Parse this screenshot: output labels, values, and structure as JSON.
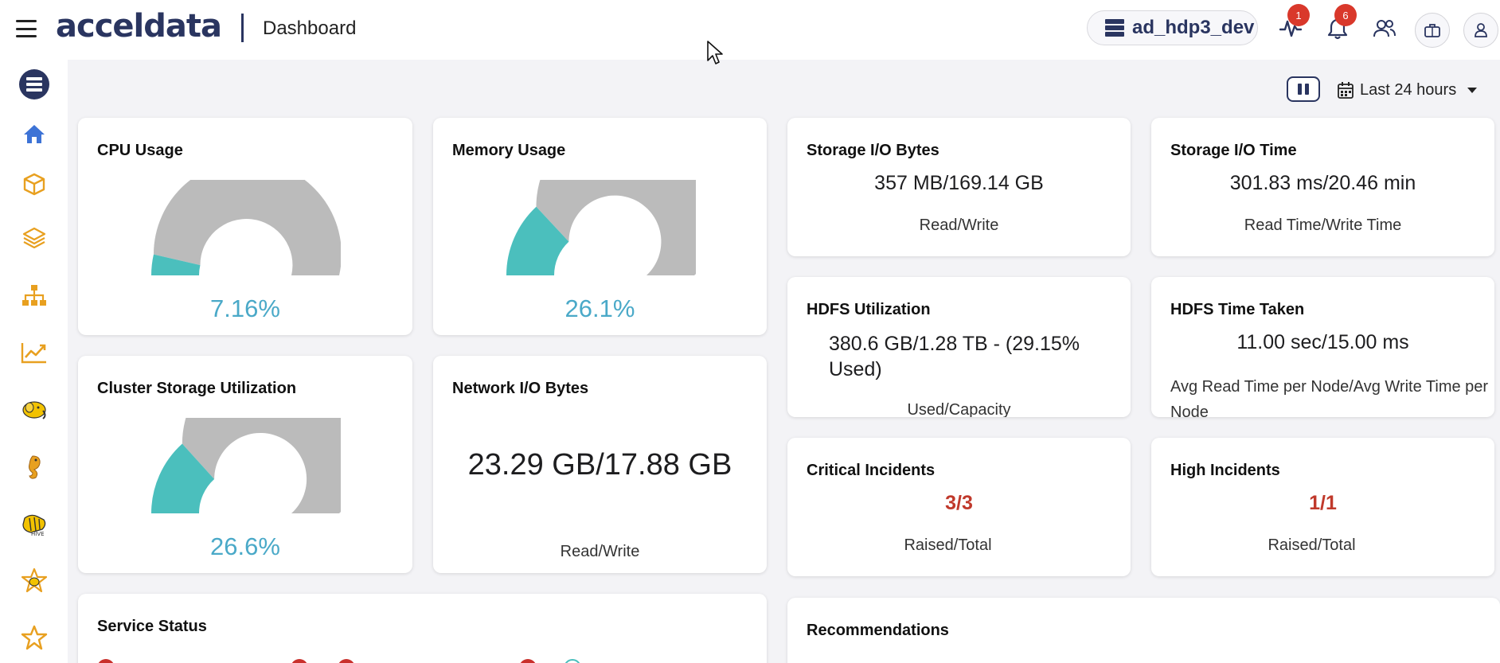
{
  "header": {
    "logo_text": "acceldata",
    "page_title": "Dashboard",
    "cluster_name": "ad_hdp3_dev",
    "alerts_badge": "1",
    "notifications_badge": "6"
  },
  "controls": {
    "time_range": "Last 24 hours"
  },
  "cards": {
    "cpu": {
      "title": "CPU Usage",
      "value": "7.16%",
      "fraction": 0.0716
    },
    "memory": {
      "title": "Memory Usage",
      "value": "26.1%",
      "fraction": 0.261
    },
    "cluster_storage": {
      "title": "Cluster Storage Utilization",
      "value": "26.6%",
      "fraction": 0.266
    },
    "network_io": {
      "title": "Network I/O Bytes",
      "value": "23.29 GB/17.88 GB",
      "label": "Read/Write"
    },
    "storage_io_bytes": {
      "title": "Storage I/O Bytes",
      "value": "357 MB/169.14 GB",
      "label": "Read/Write"
    },
    "storage_io_time": {
      "title": "Storage I/O Time",
      "value": "301.83 ms/20.46 min",
      "label": "Read Time/Write Time"
    },
    "hdfs_utilization": {
      "title": "HDFS Utilization",
      "value": "380.6 GB/1.28 TB - (29.15% Used)",
      "label": "Used/Capacity"
    },
    "hdfs_time": {
      "title": "HDFS Time Taken",
      "value": "11.00 sec/15.00 ms",
      "label": "Avg Read Time per Node/Avg Write Time per Node"
    },
    "critical_incidents": {
      "title": "Critical Incidents",
      "value": "3/3",
      "label": "Raised/Total"
    },
    "high_incidents": {
      "title": "High Incidents",
      "value": "1/1",
      "label": "Raised/Total"
    },
    "service_status": {
      "title": "Service Status"
    },
    "recommendations": {
      "title": "Recommendations"
    }
  },
  "colors": {
    "brand": "#2a3560",
    "gauge_fill": "#4bbfbd",
    "gauge_track": "#bbbbbb",
    "gauge_value": "#4aa9c8",
    "incident": "#c0392b",
    "badge": "#d9382b",
    "sidebar_icon": "#e8a020"
  },
  "icons": {
    "sidebar": [
      "server-icon",
      "home-icon",
      "cube-icon",
      "layers-icon",
      "sitemap-icon",
      "chart-line-icon",
      "hadoop-elephant-icon",
      "seahorse-icon",
      "hive-bee-icon",
      "star-bee-icon",
      "star-icon"
    ],
    "header": [
      "hamburger-icon",
      "activity-icon",
      "bell-icon",
      "users-icon",
      "briefcase-icon",
      "user-icon"
    ]
  }
}
